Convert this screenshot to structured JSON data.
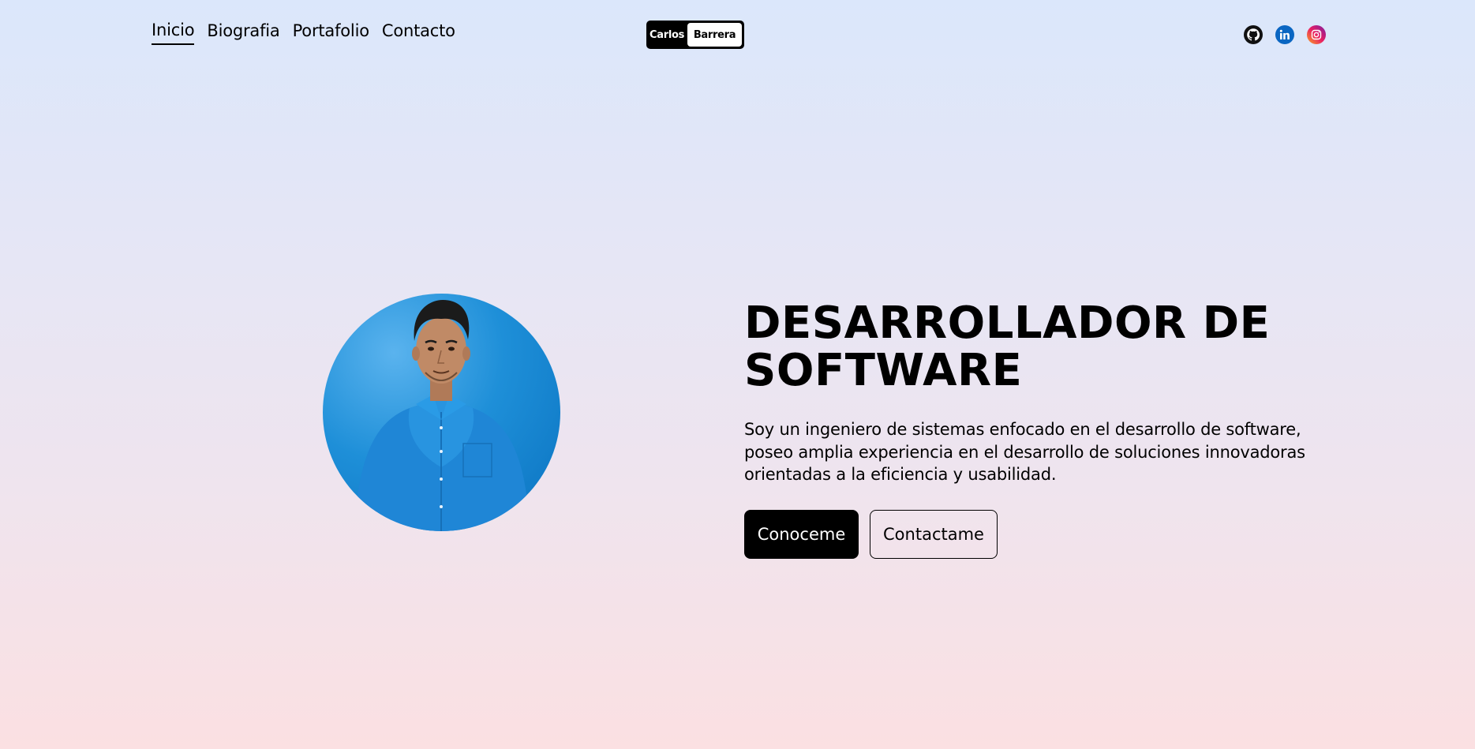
{
  "nav": {
    "items": [
      {
        "label": "Inicio",
        "active": true
      },
      {
        "label": "Biografia",
        "active": false
      },
      {
        "label": "Portafolio",
        "active": false
      },
      {
        "label": "Contacto",
        "active": false
      }
    ]
  },
  "logo": {
    "first": "Carlos",
    "second": "Barrera"
  },
  "social": [
    {
      "icon": "github-icon",
      "color": "#000000"
    },
    {
      "icon": "linkedin-icon",
      "color": "#0a66c2"
    },
    {
      "icon": "instagram-icon",
      "color": "#e91e63"
    }
  ],
  "hero": {
    "title_line1": "DESARROLLADOR DE",
    "title_line2": "SOFTWARE",
    "description": "Soy un ingeniero de sistemas enfocado en el desarrollo de software, poseo amplia experiencia en el desarrollo de soluciones innovadoras orientadas a la eficiencia y usabilidad.",
    "primary_button": "Conoceme",
    "secondary_button": "Contactame"
  },
  "colors": {
    "accent": "#000000",
    "photo_background": "#1e8fd8",
    "shirt": "#1f86d6"
  }
}
